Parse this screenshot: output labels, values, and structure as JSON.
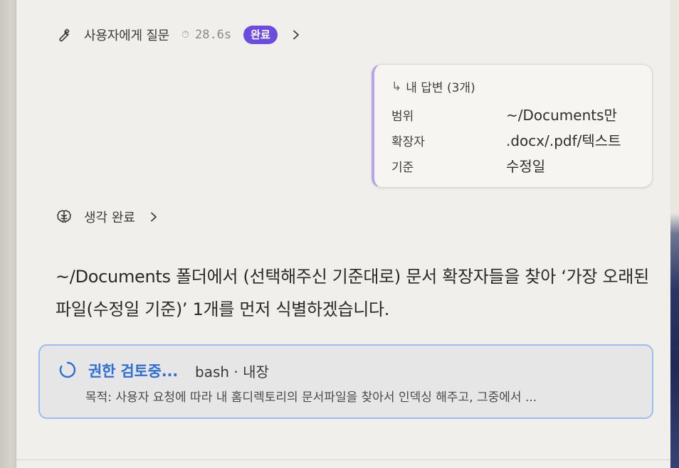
{
  "tool_call": {
    "title": "사용자에게 질문",
    "clock_icon": "⏱",
    "duration": "28.6s",
    "status_badge": "완료",
    "badge_color": "#6c4be0"
  },
  "answer": {
    "header_arrow": "↳",
    "header": "내 답변 (3개)",
    "rows": [
      {
        "label": "범위",
        "value": "~/Documents만"
      },
      {
        "label": "확장자",
        "value": ".docx/.pdf/텍스트"
      },
      {
        "label": "기준",
        "value": "수정일"
      }
    ],
    "accent_color": "#b9a2ea"
  },
  "thinking": {
    "label": "생각 완료"
  },
  "message": "~/Documents 폴더에서 (선택해주신 기준대로) 문서 확장자들을 찾아 ‘가장 오래된 파일(수정일 기준)’ 1개를 먼저 식별하겠습니다.",
  "permission": {
    "status": "권한 검토중...",
    "tool": "bash · 내장",
    "purpose": "목적: 사용자 요청에 따라 내 홈디렉토리의 문서파일을 찾아서 인덱싱 해주고, 그중에서 ...",
    "status_color": "#2f6ed6",
    "border_color": "#9cbcef"
  }
}
